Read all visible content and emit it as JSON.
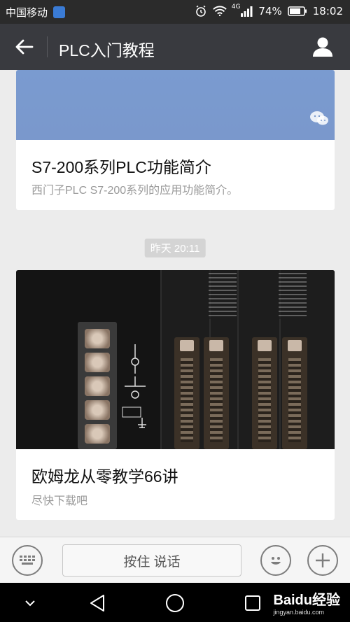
{
  "status_bar": {
    "carrier": "中国移动",
    "network": "4G",
    "battery": "74%",
    "time": "18:02"
  },
  "title_bar": {
    "title": "PLC入门教程"
  },
  "articles": [
    {
      "title": "S7-200系列PLC功能简介",
      "description": "西门子PLC S7-200系列的应用功能简介。"
    },
    {
      "title": "欧姆龙从零教学66讲",
      "description": "尽快下载吧"
    }
  ],
  "timestamp": "昨天 20:11",
  "input_bar": {
    "talk_label": "按住 说话"
  },
  "watermark": {
    "brand": "Baidu经验",
    "url": "jingyan.baidu.com"
  },
  "colors": {
    "title_bar_bg": "#393a3f",
    "status_bar_bg": "#2b2b2b",
    "page_bg": "#ececec"
  }
}
